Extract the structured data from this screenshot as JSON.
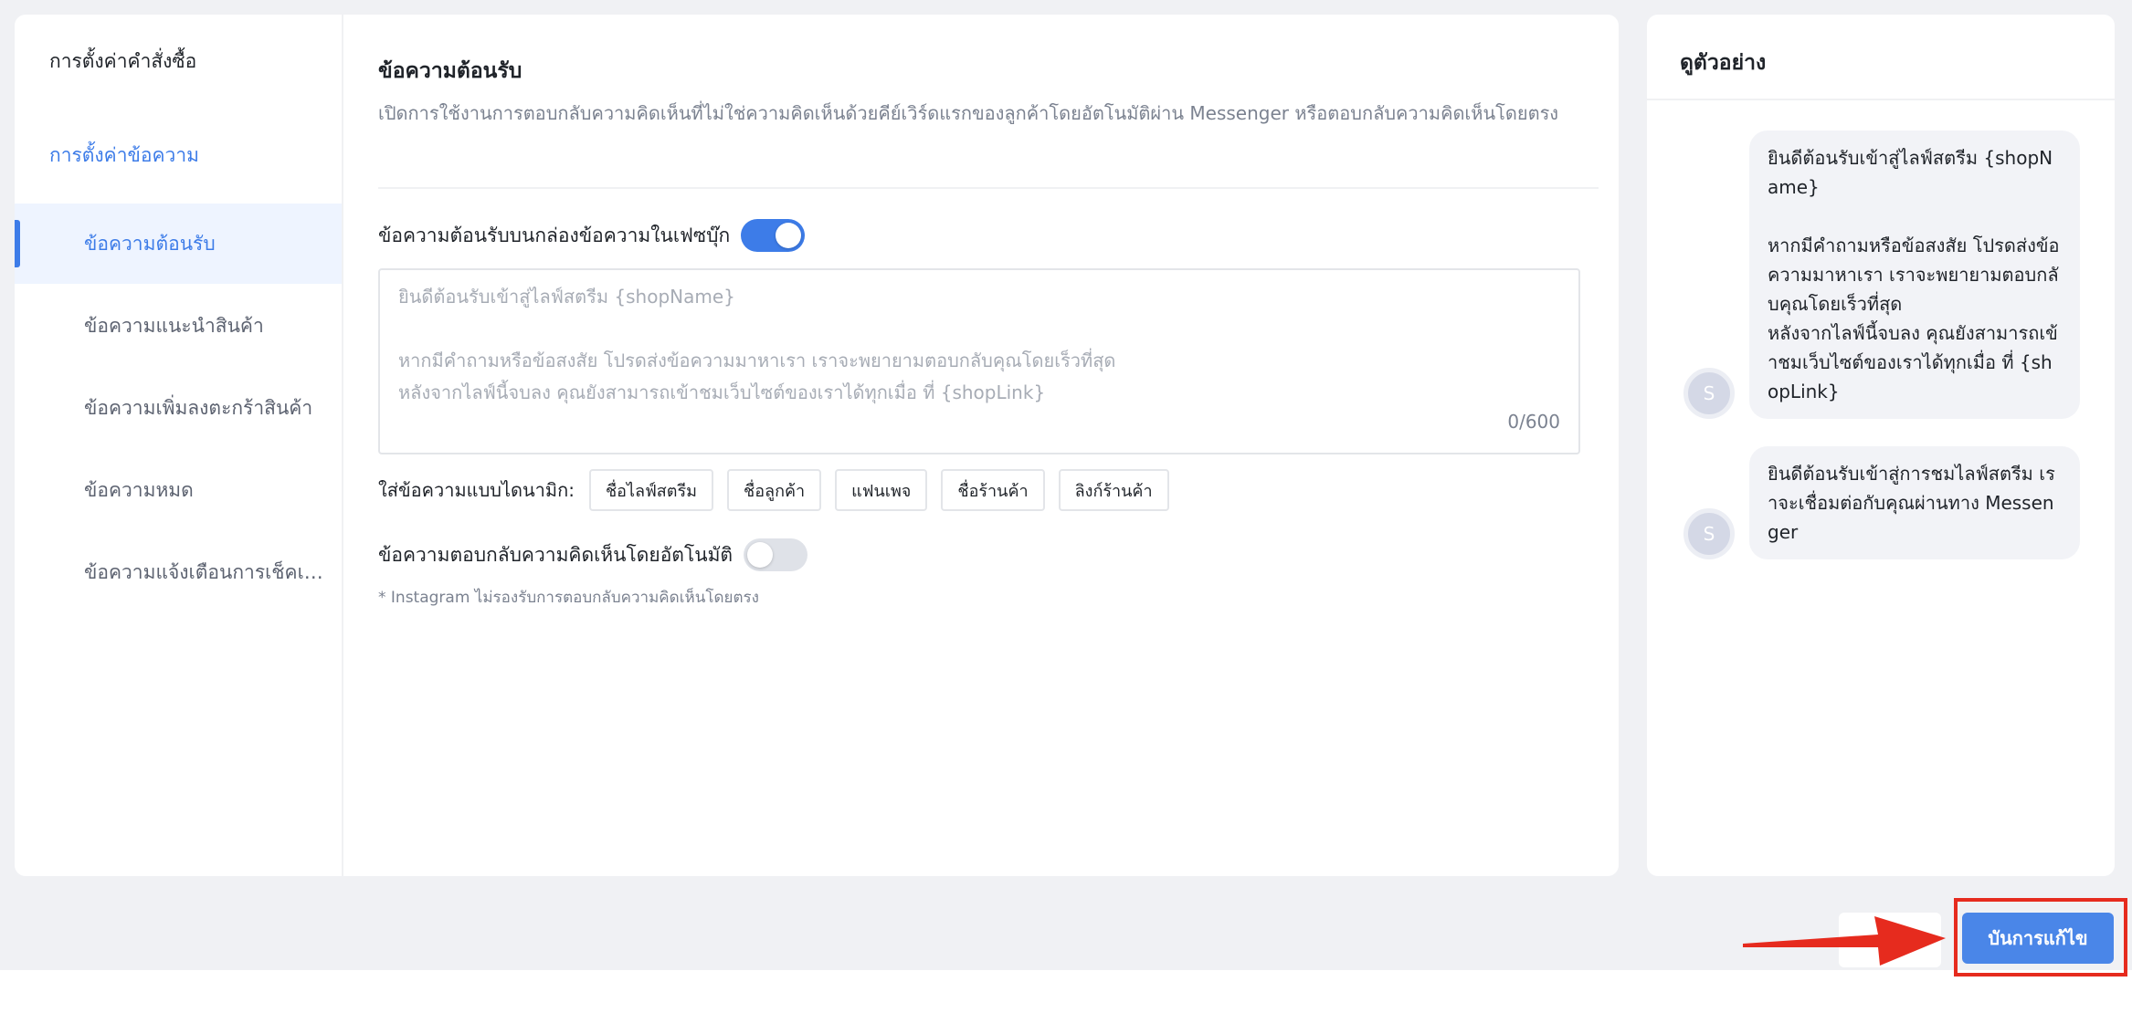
{
  "sidebar": {
    "order_settings": "การตั้งค่าคำสั่งซื้อ",
    "message_settings": "การตั้งค่าข้อความ",
    "items": [
      {
        "label": "ข้อความต้อนรับ"
      },
      {
        "label": "ข้อความแนะนำสินค้า"
      },
      {
        "label": "ข้อความเพิ่มลงตะกร้าสินค้า"
      },
      {
        "label": "ข้อความหมด"
      },
      {
        "label": "ข้อความแจ้งเตือนการเช็คเอาท์"
      }
    ]
  },
  "content": {
    "title": "ข้อความต้อนรับ",
    "description": "เปิดการใช้งานการตอบกลับความคิดเห็นที่ไม่ใช่ความคิดเห็นด้วยคีย์เวิร์ดแรกของลูกค้าโดยอัตโนมัติผ่าน Messenger หรือตอบกลับความคิดเห็นโดยตรง",
    "fb_toggle_label": "ข้อความต้อนรับบนกล่องข้อความในเฟซบุ๊ก",
    "fb_toggle_on": true,
    "message_text": "ยินดีต้อนรับเข้าสู่ไลฟ์สตรีม {shopName}\n\nหากมีคำถามหรือข้อสงสัย โปรดส่งข้อความมาหาเรา เราจะพยายามตอบกลับคุณโดยเร็วที่สุด\nหลังจากไลฟ์นี้จบลง คุณยังสามารถเข้าชมเว็บไซต์ของเราได้ทุกเมื่อ ที่ {shopLink}",
    "char_count": "0/600",
    "dynamic_label": "ใส่ข้อความแบบไดนามิก:",
    "chips": [
      "ชื่อไลฟ์สตรีม",
      "ชื่อลูกค้า",
      "แฟนเพจ",
      "ชื่อร้านค้า",
      "ลิงก์ร้านค้า"
    ],
    "auto_reply_label": "ข้อความตอบกลับความคิดเห็นโดยอัตโนมัติ",
    "auto_reply_on": false,
    "instagram_note": "* Instagram ไม่รองรับการตอบกลับความคิดเห็นโดยตรง"
  },
  "preview": {
    "title": "ดูตัวอย่าง",
    "avatar_letter": "S",
    "messages": [
      {
        "text": "ยินดีต้อนรับเข้าสู่ไลฟ์สตรีม {shopName}\n\nหากมีคำถามหรือข้อสงสัย โปรดส่งข้อความมาหาเรา เราจะพยายามตอบกลับคุณโดยเร็วที่สุด\nหลังจากไลฟ์นี้จบลง คุณยังสามารถเข้าชมเว็บไซต์ของเราได้ทุกเมื่อ ที่ {shopLink}"
      },
      {
        "text": "ยินดีต้อนรับเข้าสู่การชมไลฟ์สตรีม เราจะเชื่อมต่อกับคุณผ่านทาง Messenger"
      }
    ]
  },
  "footer": {
    "save_label": "บันการแก้ไข"
  },
  "colors": {
    "accent": "#3d7ce8",
    "highlight": "#e62b1e"
  }
}
